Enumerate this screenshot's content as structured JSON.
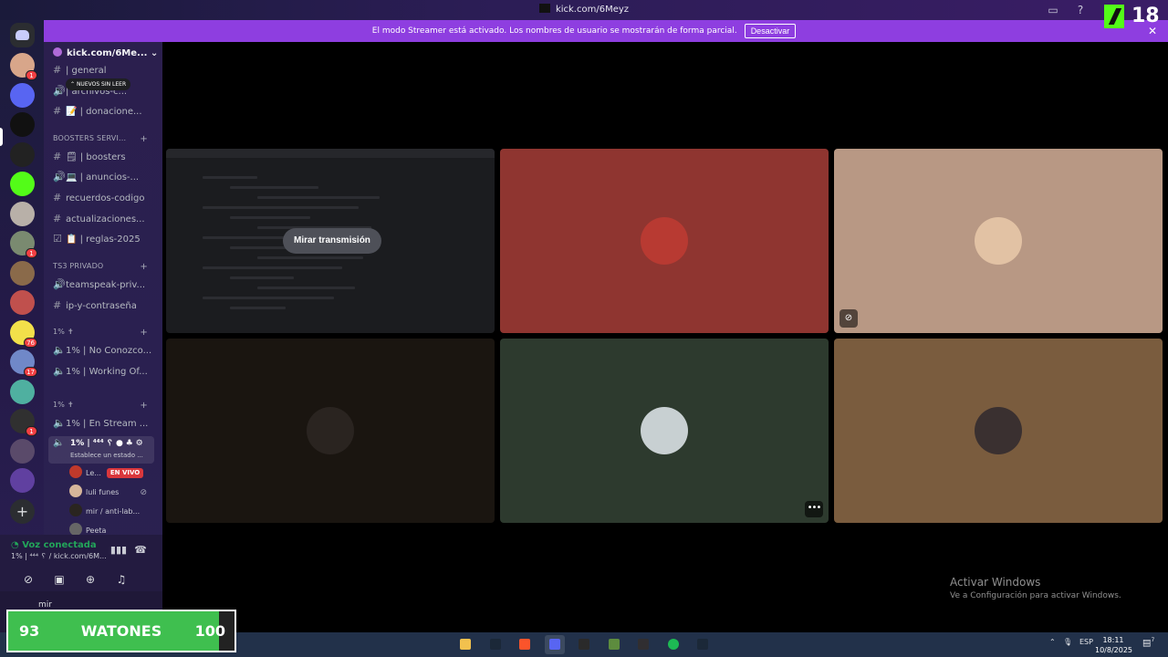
{
  "window": {
    "title": "kick.com/6Meyz"
  },
  "banner": {
    "text": "El modo Streamer está activado. Los nombres de usuario se mostrarán de forma parcial.",
    "button": "Desactivar"
  },
  "overlay": {
    "age_badge": "18"
  },
  "servers": [
    {
      "badge": "1",
      "color": "#d8a68a"
    },
    {
      "badge": "",
      "color": "#5865f2"
    },
    {
      "badge": "",
      "color": "#111111"
    },
    {
      "badge": "",
      "color": "#222222"
    },
    {
      "badge": "",
      "color": "#53fc18"
    },
    {
      "badge": "",
      "color": "#b8b0a8"
    },
    {
      "badge": "1",
      "color": "#7a8a70"
    },
    {
      "badge": "",
      "color": "#8a6a4a"
    },
    {
      "badge": "",
      "color": "#c0504d"
    },
    {
      "badge": "76",
      "color": "#f2e04a"
    },
    {
      "badge": "17",
      "color": "#7088c8"
    },
    {
      "badge": "",
      "color": "#4fb0a0"
    },
    {
      "badge": "1",
      "color": "#303030"
    },
    {
      "badge": "",
      "color": "#5a4a6a"
    },
    {
      "badge": "",
      "color": "#6040a0"
    }
  ],
  "sidebar": {
    "server_name": "kick.com/6Me...",
    "unread_pill": "NUEVOS SIN LEER",
    "channels_top": [
      {
        "icon": "#",
        "name": "| general"
      },
      {
        "icon": "🔊",
        "name": "| archivos-c..."
      },
      {
        "icon": "#",
        "name": "📝 | donacione..."
      }
    ],
    "cat1": "BOOSTERS SERVI...",
    "cat1_channels": [
      {
        "icon": "#",
        "name": "🗒 | boosters"
      },
      {
        "icon": "🔊",
        "name": "💻 | anuncios-..."
      },
      {
        "icon": "#",
        "name": "recuerdos-codigo"
      },
      {
        "icon": "#",
        "name": "actualizaciones..."
      },
      {
        "icon": "☑",
        "name": "📋 | reglas-2025"
      }
    ],
    "cat2": "TS3 PRIVADO",
    "cat2_channels": [
      {
        "icon": "🔊",
        "name": "teamspeak-priv..."
      },
      {
        "icon": "#",
        "name": "ip-y-contraseña"
      }
    ],
    "cat3": "1% ✝",
    "cat3_channels": [
      {
        "icon": "🔈",
        "name": "1% | No Conozco..."
      },
      {
        "icon": "🔈",
        "name": "1% | Working Of..."
      }
    ],
    "cat4": "1% ✝",
    "cat4_channels": [
      {
        "icon": "🔈",
        "name": "1% | En Stream ..."
      }
    ],
    "active_voice": {
      "name": "1% | ⁴⁴⁴ ␦",
      "status": "Establece un estado ..."
    },
    "voice_users": [
      {
        "name": "Le...",
        "live": "EN VIVO",
        "color": "#c0392b"
      },
      {
        "name": "luli funes",
        "live": "",
        "color": "#d6b59a"
      },
      {
        "name": "mir / anti-lab...",
        "live": "",
        "color": "#2a2520"
      },
      {
        "name": "Peeta",
        "live": "",
        "color": "#666666"
      }
    ]
  },
  "voice_panel": {
    "status": "Voz conectada",
    "channel": "1% | ⁴⁴⁴ ␦ / kick.com/6M...",
    "user": "mir"
  },
  "tiles": [
    {
      "bg": "#1b1c1f",
      "kind": "stream",
      "avatar": ""
    },
    {
      "bg": "#8f3530",
      "kind": "user",
      "avatar": "#b83a32"
    },
    {
      "bg": "#b89884",
      "kind": "user",
      "avatar": "#e2c2a4"
    },
    {
      "bg": "#1a1510",
      "kind": "user",
      "avatar": "#2a2420"
    },
    {
      "bg": "#2d3a2e",
      "kind": "user",
      "avatar": "#c8d0d2"
    },
    {
      "bg": "#7a5c3e",
      "kind": "user",
      "avatar": "#3a3030"
    }
  ],
  "stream_tile": {
    "watch_label": "Mirar transmisión"
  },
  "activate_windows": {
    "title": "Activar Windows",
    "subtitle": "Ve a Configuración para activar Windows."
  },
  "watones": {
    "current": "93",
    "label": "WATONES",
    "goal": "100",
    "progress": 0.93
  },
  "taskbar": {
    "apps": [
      {
        "name": "file-explorer",
        "color": "#f2c14e"
      },
      {
        "name": "steam",
        "color": "#1b2838"
      },
      {
        "name": "brave",
        "color": "#fb542b"
      },
      {
        "name": "discord",
        "color": "#5865f2"
      },
      {
        "name": "epic-games",
        "color": "#2a2a2a"
      },
      {
        "name": "minecraft",
        "color": "#5d8c3e"
      },
      {
        "name": "obs",
        "color": "#302e31"
      },
      {
        "name": "spotify",
        "color": "#1db954"
      },
      {
        "name": "steam-2",
        "color": "#1b2838"
      }
    ],
    "lang": "ESP",
    "time": "18:11",
    "date": "10/8/2025",
    "notif": "7"
  }
}
